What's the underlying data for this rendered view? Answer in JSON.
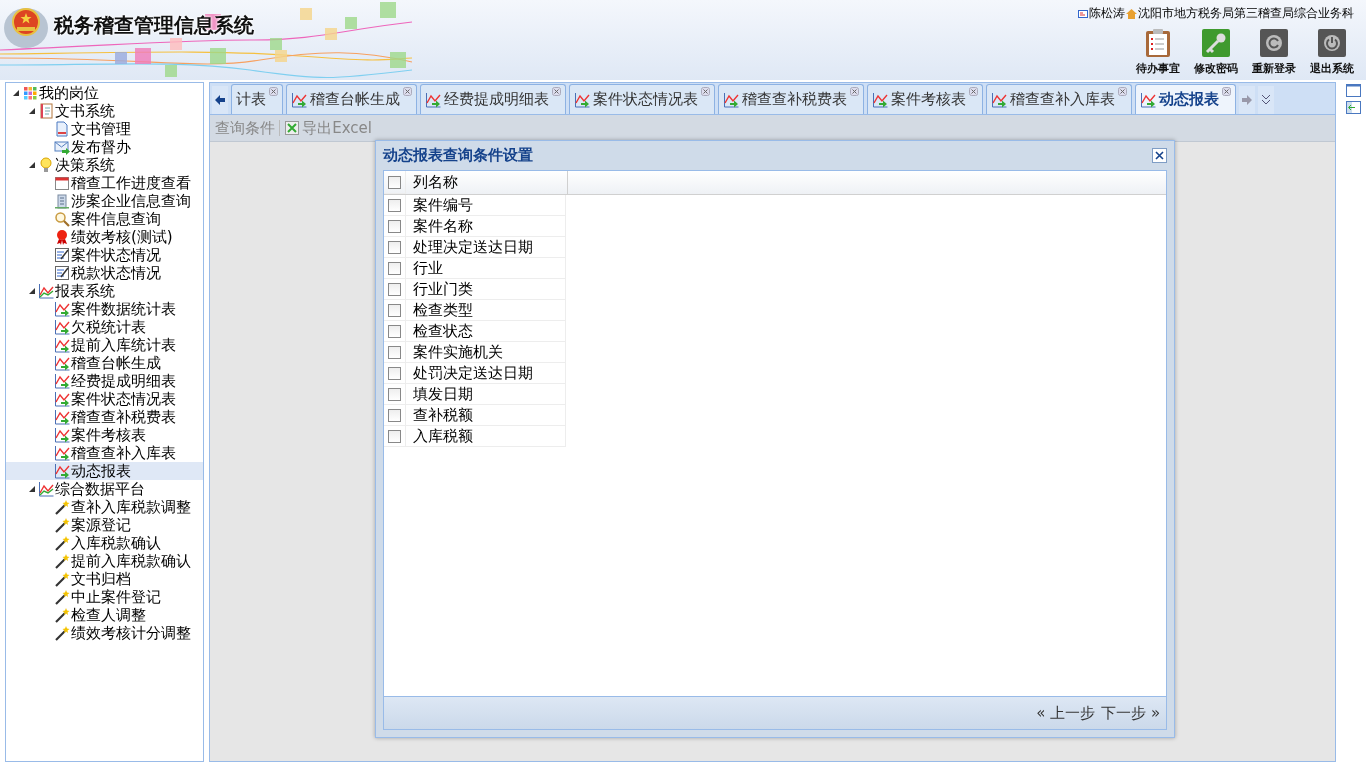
{
  "header": {
    "title": "税务稽查管理信息系统",
    "user": "陈松涛",
    "org": "沈阳市地方税务局第三稽查局综合业务科",
    "buttons": [
      {
        "label": "待办事宜",
        "kind": "clipboard"
      },
      {
        "label": "修改密码",
        "kind": "key"
      },
      {
        "label": "重新登录",
        "kind": "relogin"
      },
      {
        "label": "退出系统",
        "kind": "power"
      }
    ]
  },
  "tree": [
    {
      "label": "我的岗位",
      "kind": "grid",
      "expanded": true,
      "selected": false,
      "children": [
        {
          "label": "文书系统",
          "kind": "notebook",
          "expanded": true,
          "selected": false,
          "children": [
            {
              "label": "文书管理",
              "kind": "doc",
              "selected": false
            },
            {
              "label": "发布督办",
              "kind": "mail",
              "selected": false
            }
          ]
        },
        {
          "label": "决策系统",
          "kind": "bulb",
          "expanded": true,
          "selected": false,
          "children": [
            {
              "label": "稽查工作进度查看",
              "kind": "calendar",
              "selected": false
            },
            {
              "label": "涉案企业信息查询",
              "kind": "building",
              "selected": false
            },
            {
              "label": "案件信息查询",
              "kind": "search",
              "selected": false
            },
            {
              "label": "绩效考核(测试)",
              "kind": "ribbon",
              "selected": false
            },
            {
              "label": "案件状态情况",
              "kind": "edit",
              "selected": false
            },
            {
              "label": "税款状态情况",
              "kind": "edit",
              "selected": false
            }
          ]
        },
        {
          "label": "报表系统",
          "kind": "chart",
          "expanded": true,
          "selected": false,
          "children": [
            {
              "label": "案件数据统计表",
              "kind": "report",
              "selected": false
            },
            {
              "label": "欠税统计表",
              "kind": "report",
              "selected": false
            },
            {
              "label": "提前入库统计表",
              "kind": "report",
              "selected": false
            },
            {
              "label": "稽查台帐生成",
              "kind": "report",
              "selected": false
            },
            {
              "label": "经费提成明细表",
              "kind": "report",
              "selected": false
            },
            {
              "label": "案件状态情况表",
              "kind": "report",
              "selected": false
            },
            {
              "label": "稽查查补税费表",
              "kind": "report",
              "selected": false
            },
            {
              "label": "案件考核表",
              "kind": "report",
              "selected": false
            },
            {
              "label": "稽查查补入库表",
              "kind": "report",
              "selected": false
            },
            {
              "label": "动态报表",
              "kind": "report",
              "selected": true
            }
          ]
        },
        {
          "label": "综合数据平台",
          "kind": "chart",
          "expanded": true,
          "selected": false,
          "children": [
            {
              "label": "查补入库税款调整",
              "kind": "wand",
              "selected": false
            },
            {
              "label": "案源登记",
              "kind": "wand",
              "selected": false
            },
            {
              "label": "入库税款确认",
              "kind": "wand",
              "selected": false
            },
            {
              "label": "提前入库税款确认",
              "kind": "wand",
              "selected": false
            },
            {
              "label": "文书归档",
              "kind": "wand",
              "selected": false
            },
            {
              "label": "中止案件登记",
              "kind": "wand",
              "selected": false
            },
            {
              "label": "检查人调整",
              "kind": "wand",
              "selected": false
            },
            {
              "label": "绩效考核计分调整",
              "kind": "wand",
              "selected": false
            }
          ]
        }
      ]
    }
  ],
  "tabs": [
    {
      "label": "计表",
      "icon": false,
      "selected": false
    },
    {
      "label": "稽查台帐生成",
      "icon": true,
      "selected": false
    },
    {
      "label": "经费提成明细表",
      "icon": true,
      "selected": false
    },
    {
      "label": "案件状态情况表",
      "icon": true,
      "selected": false
    },
    {
      "label": "稽查查补税费表",
      "icon": true,
      "selected": false
    },
    {
      "label": "案件考核表",
      "icon": true,
      "selected": false
    },
    {
      "label": "稽查查补入库表",
      "icon": true,
      "selected": false
    },
    {
      "label": "动态报表",
      "icon": true,
      "selected": true
    }
  ],
  "toolbar": [
    {
      "label": "查询条件",
      "icon": false
    },
    {
      "label": "导出Excel",
      "icon": true
    }
  ],
  "dialog": {
    "title": "动态报表查询条件设置",
    "header": {
      "label": "列名称",
      "checked": false
    },
    "rows": [
      {
        "label": "案件编号",
        "checked": false
      },
      {
        "label": "案件名称",
        "checked": false
      },
      {
        "label": "处理决定送达日期",
        "checked": false
      },
      {
        "label": "行业",
        "checked": false
      },
      {
        "label": "行业门类",
        "checked": false
      },
      {
        "label": "检查类型",
        "checked": false
      },
      {
        "label": "检查状态",
        "checked": false
      },
      {
        "label": "案件实施机关",
        "checked": false
      },
      {
        "label": "处罚决定送达日期",
        "checked": false
      },
      {
        "label": "填发日期",
        "checked": false
      },
      {
        "label": "查补税额",
        "checked": false
      },
      {
        "label": "入库税额",
        "checked": false
      }
    ],
    "prev": "« 上一步",
    "next": "下一步 »"
  }
}
